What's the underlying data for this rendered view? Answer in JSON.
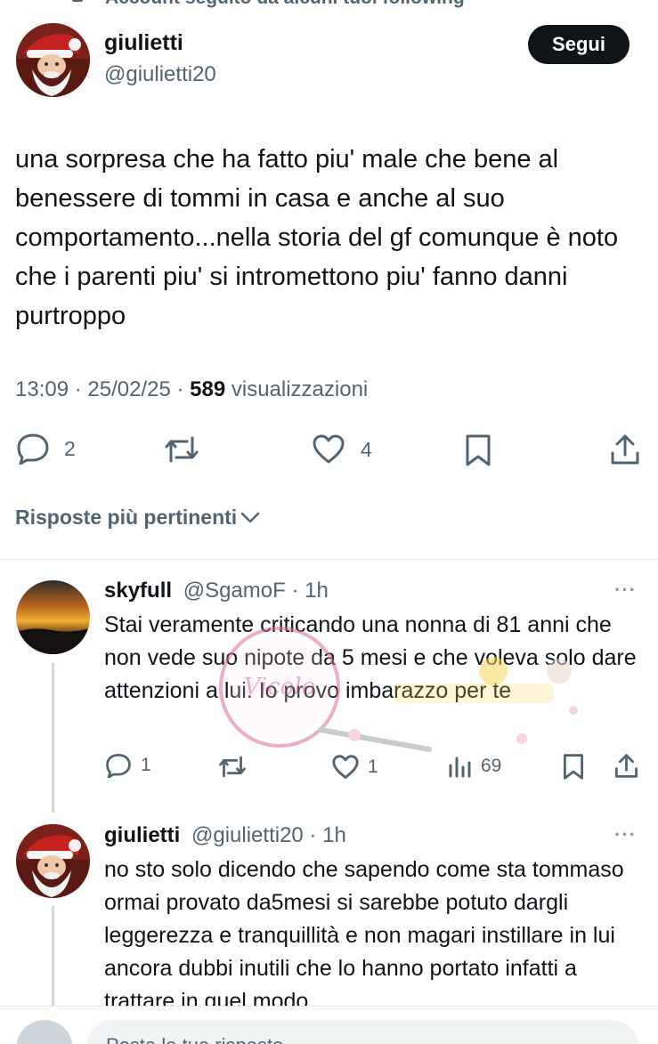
{
  "top_notice": "Account seguito da alcuni tuoi following",
  "tweet": {
    "author_name": "giulietti",
    "author_handle": "@giulietti20",
    "follow_label": "Segui",
    "text": "una sorpresa che ha fatto piu' male che bene al benessere di tommi in casa e anche al suo comportamento...nella storia del gf comunque è noto che i parenti piu' si intromettono piu' fanno danni purtroppo",
    "time_date": "13:09 · 25/02/25 · ",
    "views_count": "589",
    "views_label": " visualizzazioni",
    "replies": "2",
    "likes": "4"
  },
  "sort_label": "Risposte più pertinenti",
  "replies": [
    {
      "name": "skyfull",
      "handle_time": "@SgamoF · 1h",
      "text": "Stai veramente criticando una nonna di 81 anni che non vede suo nipote da 5 mesi e che voleva solo dare attenzioni a lui. Io provo imbarazzo per te",
      "replies": "1",
      "likes": "1",
      "views": "69"
    },
    {
      "name": "giulietti",
      "handle_time": "@giulietti20 · 1h",
      "text": "no sto solo dicendo che sapendo come sta tommaso ormai provato da5mesi si sarebbe potuto dargli leggerezza e tranquillità e non magari instillare in lui ancora dubbi inutili che lo hanno portato infatti a trattare in quel modo"
    }
  ],
  "reply_box": {
    "placeholder": "Posta la tua risposta"
  },
  "watermark_text": "Vicolo News",
  "colors": {
    "text": "#0f1419",
    "secondary": "#536471",
    "button": "#0f1419",
    "divider": "#e4e8eb"
  }
}
